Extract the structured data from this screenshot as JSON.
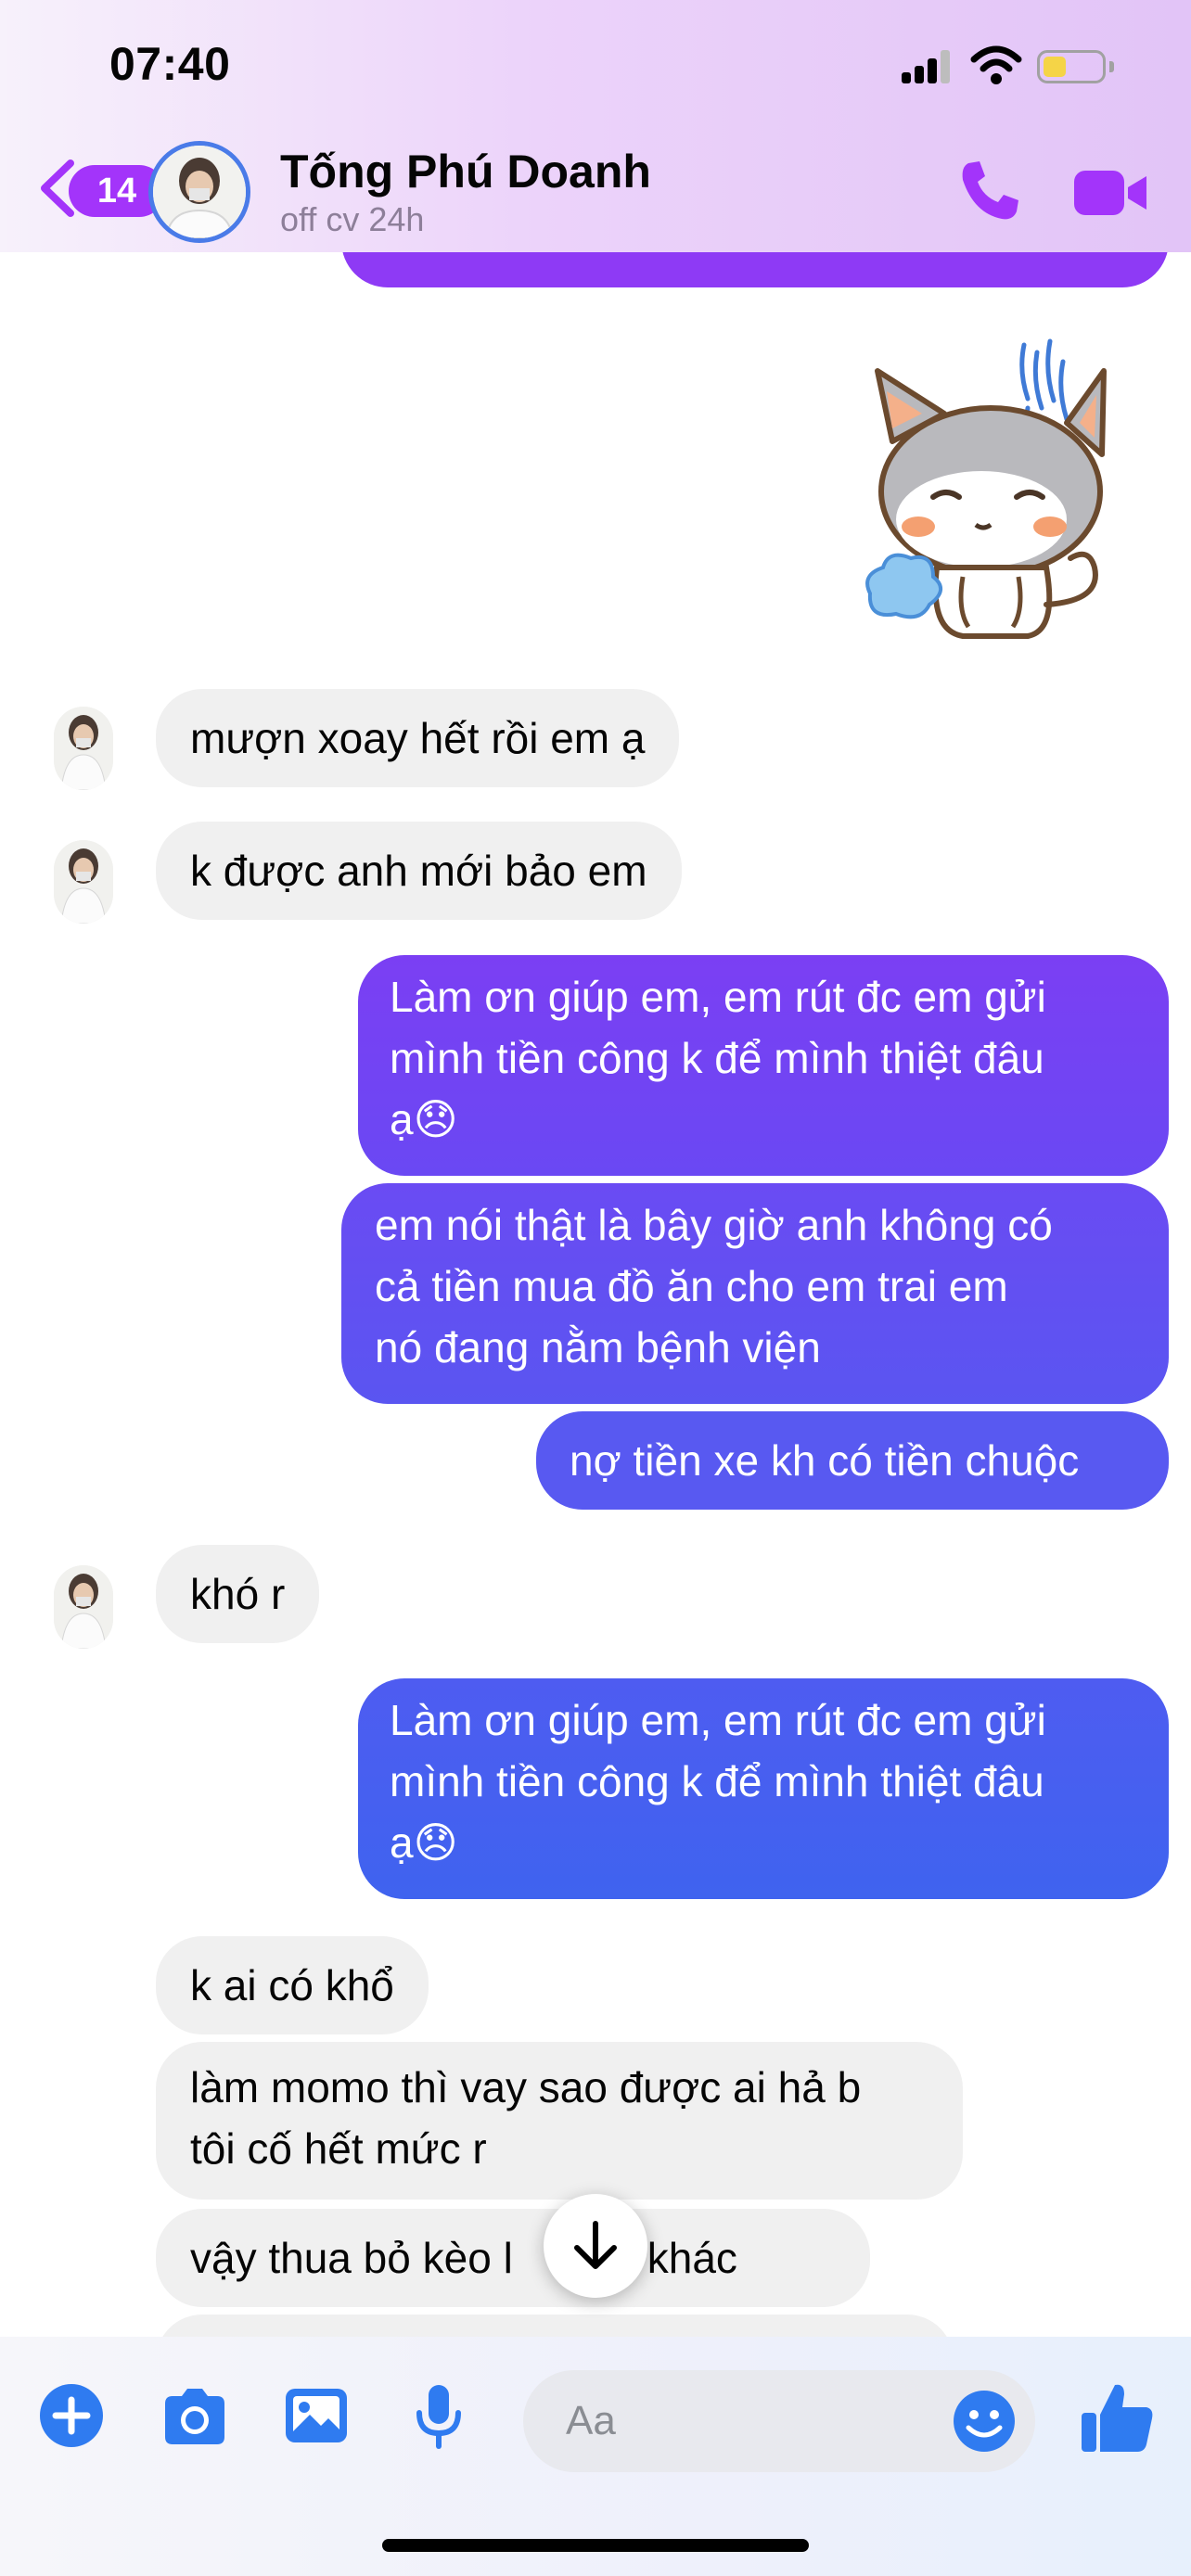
{
  "status_bar": {
    "time": "07:40"
  },
  "header": {
    "back_count": "14",
    "contact_name": "Tống Phú Doanh",
    "contact_status": "off cv 24h",
    "icons": [
      "back-chevron-icon",
      "phone-icon",
      "video-camera-icon"
    ]
  },
  "messages": [
    {
      "dir": "in",
      "text": "mượn xoay hết rồi em ạ"
    },
    {
      "dir": "in",
      "text": "k được anh mới bảo em"
    },
    {
      "dir": "out",
      "line1": "Làm ơn giúp em, em rút đc em gửi",
      "line2": "mình tiền công k để mình thiệt đâu",
      "line3": "ạ😞"
    },
    {
      "dir": "out",
      "line1": "em nói thật là bây giờ anh không có",
      "line2": "cả tiền mua đồ ăn cho em trai em",
      "line3": "nó đang nằm bệnh viện"
    },
    {
      "dir": "out",
      "text": "nợ tiền xe kh có tiền chuộc"
    },
    {
      "dir": "in",
      "text": "khó r"
    },
    {
      "dir": "out",
      "line1": "Làm ơn giúp em, em rút đc em gửi",
      "line2": "mình tiền công k để mình thiệt đâu",
      "line3": "ạ😞"
    },
    {
      "dir": "in",
      "text": "k ai có khổ"
    },
    {
      "dir": "in",
      "line1": "làm momo thì vay sao được ai hả b",
      "line2": "tôi cố hết mức r"
    },
    {
      "dir": "in",
      "text": "vậy thua bỏ kèo l",
      "text_after": "kèo khác"
    }
  ],
  "composer": {
    "placeholder": "Aa",
    "icons": [
      "plus-icon",
      "camera-icon",
      "image-icon",
      "microphone-icon",
      "emoji-icon",
      "thumbs-up-icon"
    ]
  },
  "colors": {
    "accent": "#a334fa",
    "outgoing_top": "#7b3ff3",
    "outgoing_bottom": "#3f63ef",
    "incoming": "#f0f0f0"
  }
}
